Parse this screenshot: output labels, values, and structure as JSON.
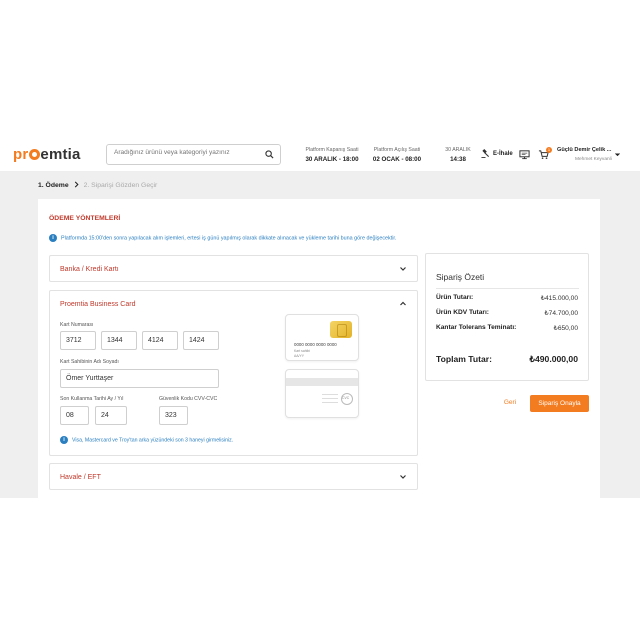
{
  "header": {
    "logo": {
      "pre": "pr",
      "post": "emtia"
    },
    "search": {
      "placeholder": "Aradığınız ürünü veya kategoriyi yazınız"
    },
    "platform_close": {
      "label": "Platform Kapanış Saati",
      "value": "30 ARALIK - 18:00"
    },
    "platform_open": {
      "label": "Platform Açılış Saati",
      "value": "02 OCAK - 08:00"
    },
    "clock": {
      "date": "30 ARALIK",
      "time": "14:38"
    },
    "auction_label": "E-İhale",
    "cart_count": "1",
    "user": {
      "name": "Güçlü Demir Çelik ...",
      "role": "Mehmet Keyvanli"
    }
  },
  "breadcrumb": {
    "step1": "1. Ödeme",
    "step2": "2. Siparişi Gözden Geçir"
  },
  "payment": {
    "title": "ÖDEME YÖNTEMLERİ",
    "info": "Platformda 15:00'den sonra yapılacak alım işlemleri, ertesi iş günü yapılmış olarak dikkate alınacak ve yükleme tarihi buna göre değişecektir.",
    "bank_card_label": "Banka / Kredi Kartı",
    "business_card_label": "Proemtia Business Card",
    "card_number_label": "Kart Numarası",
    "card_number": [
      "3712",
      "1344",
      "4124",
      "1424"
    ],
    "holder_label": "Kart Sahibinin Adı Soyadı",
    "holder": "Ömer Yurttaşer",
    "expiry_label": "Son Kullanma Tarihi Ay / Yıl",
    "expiry_month": "08",
    "expiry_year": "24",
    "cvc_label": "Güvenlik Kodu CVV-CVC",
    "cvc": "323",
    "card_preview": {
      "number": "0000 0000 0000 0000",
      "name": "Kart sahibi",
      "expiry": "AA/YY",
      "back_text": "CVC"
    },
    "cvc_note": "Visa, Mastercard ve Troy'tan arka yüzündeki son 3 haneyi girmelisiniz.",
    "eft_label": "Havale / EFT"
  },
  "summary": {
    "title": "Sipariş Özeti",
    "rows": [
      {
        "label": "Ürün Tutarı:",
        "value": "₺415.000,00"
      },
      {
        "label": "Ürün KDV Tutarı:",
        "value": "₺74.700,00"
      },
      {
        "label": "Kantar Tolerans Teminatı:",
        "value": "₺650,00"
      }
    ],
    "total_label": "Toplam Tutar:",
    "total_value": "₺490.000,00"
  },
  "actions": {
    "back": "Geri",
    "confirm": "Sipariş Onayla"
  },
  "colors": {
    "brand": "#f47c20",
    "title_red": "#c0392b",
    "info_blue": "#2a7fc1"
  }
}
